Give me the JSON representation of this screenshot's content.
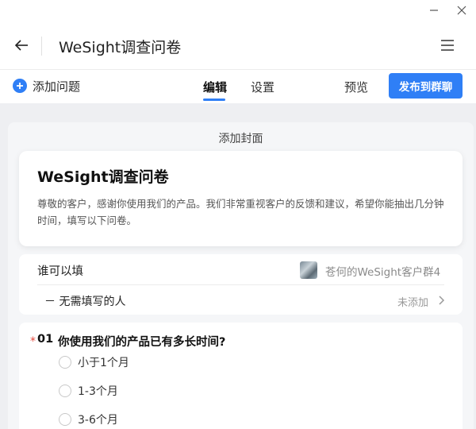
{
  "header": {
    "title": "WeSight调查问卷"
  },
  "toolbar": {
    "add_question_label": "添加问题",
    "tabs": [
      {
        "label": "编辑",
        "active": true
      },
      {
        "label": "设置",
        "active": false
      }
    ],
    "preview_label": "预览",
    "publish_label": "发布到群聊"
  },
  "cover": {
    "add_cover_label": "添加封面",
    "title": "WeSight调查问卷",
    "description": "尊敬的客户，感谢你使用我们的产品。我们非常重视客户的反馈和建议，希望你能抽出几分钟时间，填写以下问卷。"
  },
  "audience": {
    "who_label": "谁可以填",
    "group_name": "苍何的WeSight客户群4",
    "exclude_label": "－ 无需填写的人",
    "exclude_status": "未添加"
  },
  "question": {
    "required_mark": "*",
    "number": "01",
    "title": "你使用我们的产品已有多长时间?",
    "options": [
      "小于1个月",
      "1-3个月",
      "3-6个月"
    ]
  },
  "colors": {
    "accent": "#2f7ff6",
    "required": "#e5483c",
    "background": "#eeeff2"
  },
  "icons": {
    "back": "arrow-left-icon",
    "menu": "hamburger-menu-icon",
    "add": "plus-circle-icon",
    "chevron": "chevron-right-icon",
    "minimize": "minimize-icon",
    "close": "close-icon"
  }
}
